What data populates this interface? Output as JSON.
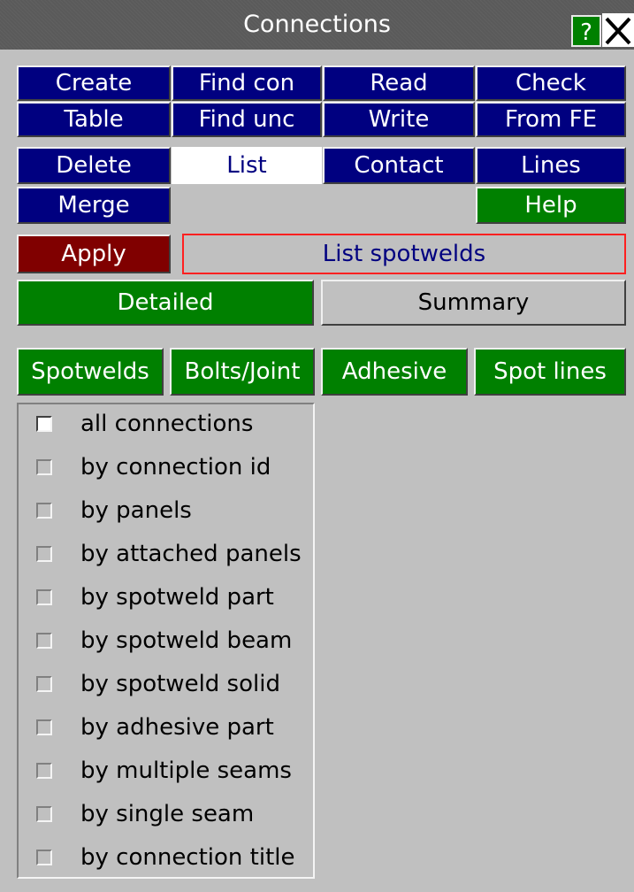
{
  "window": {
    "title": "Connections",
    "help_label": "?"
  },
  "menu": {
    "row1": [
      "Create",
      "Find con",
      "Read",
      "Check"
    ],
    "row2": [
      "Table",
      "Find unc",
      "Write",
      "From FE"
    ],
    "row3": [
      "Delete",
      "List",
      "Contact",
      "Lines"
    ],
    "merge": "Merge",
    "help": "Help",
    "selected": "List"
  },
  "action": {
    "apply": "Apply",
    "description": "List spotwelds"
  },
  "mode_tabs": {
    "detailed": "Detailed",
    "summary": "Summary",
    "selected": "Detailed"
  },
  "type_tabs": [
    "Spotwelds",
    "Bolts/Joint",
    "Adhesive",
    "Spot lines"
  ],
  "options": [
    {
      "label": "all connections",
      "checked": false,
      "style": "white"
    },
    {
      "label": "by connection id",
      "checked": false
    },
    {
      "label": "by panels",
      "checked": false
    },
    {
      "label": "by attached panels",
      "checked": false
    },
    {
      "label": "by spotweld part",
      "checked": false
    },
    {
      "label": "by spotweld beam",
      "checked": false
    },
    {
      "label": "by spotweld solid",
      "checked": false
    },
    {
      "label": "by adhesive part",
      "checked": false
    },
    {
      "label": "by multiple seams",
      "checked": false
    },
    {
      "label": "by single seam",
      "checked": false
    },
    {
      "label": "by connection title",
      "checked": false
    }
  ],
  "colors": {
    "navy": "#000080",
    "green": "#008000",
    "maroon": "#800000",
    "panel_gray": "#c0c0c0",
    "apply_border": "#ff2020"
  }
}
